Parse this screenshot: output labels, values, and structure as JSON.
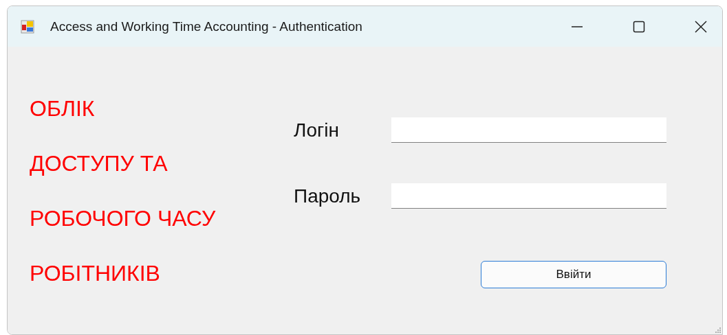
{
  "window": {
    "title": "Access and Working Time Accounting - Authentication"
  },
  "heading_lines": [
    "ОБЛІК",
    "ДОСТУПУ ТА",
    "РОБОЧОГО ЧАСУ",
    "РОБІТНИКІВ"
  ],
  "fields": [
    {
      "label": "Логін"
    },
    {
      "label": "Пароль"
    }
  ],
  "button": {
    "label": "Ввійти"
  }
}
